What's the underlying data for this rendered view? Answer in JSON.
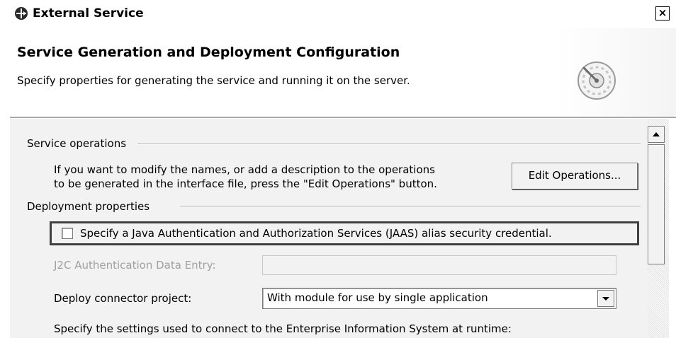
{
  "window": {
    "title": "External Service",
    "close_label": "×"
  },
  "header": {
    "title": "Service Generation and Deployment Configuration",
    "description": "Specify properties for generating the service and running it on the server."
  },
  "service_operations": {
    "section_label": "Service operations",
    "help_line1": "If you want to modify the names, or add a description to the operations",
    "help_line2": "to be generated in the interface file, press the \"Edit Operations\" button.",
    "edit_button_label": "Edit Operations..."
  },
  "deployment_properties": {
    "section_label": "Deployment properties",
    "jaas_checkbox_label": "Specify a Java Authentication and Authorization Services (JAAS) alias security credential.",
    "jaas_checked": false,
    "j2c_label": "J2C Authentication Data Entry:",
    "j2c_value": "",
    "deploy_label": "Deploy connector project:",
    "deploy_value": "With module for use by single application",
    "runtime_text": "Specify the settings used to connect to the Enterprise Information System at runtime:"
  },
  "icons": {
    "title": "service-wizard-icon",
    "header": "gauge-dial-icon"
  }
}
